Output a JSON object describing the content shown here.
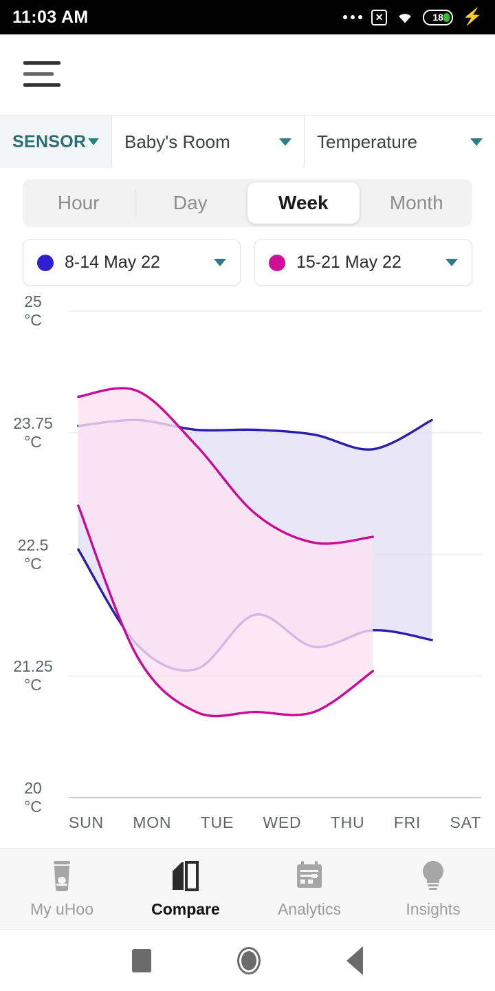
{
  "status_bar": {
    "time": "11:03 AM",
    "battery_level": "18",
    "icons": [
      "more-dots-icon",
      "x-box-icon",
      "wifi-icon",
      "battery-icon",
      "charging-bolt-icon"
    ]
  },
  "app_bar": {
    "menu_icon": "hamburger-menu-icon"
  },
  "selectors": [
    {
      "name": "sensor",
      "label": "SENSOR",
      "accent": "#2b6e76"
    },
    {
      "name": "room",
      "label": "Baby's Room"
    },
    {
      "name": "metric",
      "label": "Temperature"
    }
  ],
  "range_tabs": {
    "items": [
      "Hour",
      "Day",
      "Week",
      "Month"
    ],
    "selected": "Week"
  },
  "date_pickers": [
    {
      "label": "8-14 May 22",
      "color": "#2f1fd0"
    },
    {
      "label": "15-21 May 22",
      "color": "#cf0d98"
    }
  ],
  "bottom_nav": {
    "items": [
      {
        "label": "My uHoo",
        "icon": "device-icon",
        "active": false
      },
      {
        "label": "Compare",
        "icon": "compare-icon",
        "active": true
      },
      {
        "label": "Analytics",
        "icon": "calendar-icon",
        "active": false
      },
      {
        "label": "Insights",
        "icon": "lightbulb-icon",
        "active": false
      }
    ]
  },
  "system_nav": {
    "items": [
      "recents-square-icon",
      "home-circle-icon",
      "back-triangle-icon"
    ]
  },
  "chart_data": {
    "type": "area",
    "title": "",
    "xlabel": "",
    "ylabel": "°C",
    "ylim": [
      20,
      25
    ],
    "yticks": [
      25,
      23.75,
      22.5,
      21.25,
      20
    ],
    "ytick_labels": [
      "25\n°C",
      "23.75\n°C",
      "22.5\n°C",
      "21.25\n°C",
      "20\n°C"
    ],
    "categories": [
      "SUN",
      "MON",
      "TUE",
      "WED",
      "THU",
      "FRI",
      "SAT"
    ],
    "grid": true,
    "legend_position": "top",
    "series": [
      {
        "name": "8-14 May 22",
        "color": "#2a1ea8",
        "fill": "#e4e2f6",
        "band": true,
        "x": [
          "SUN",
          "MON",
          "TUE",
          "WED",
          "THU",
          "FRI",
          "SAT"
        ],
        "upper": [
          23.82,
          23.88,
          23.78,
          23.78,
          23.73,
          23.58,
          23.88
        ],
        "lower": [
          22.55,
          21.57,
          21.32,
          21.88,
          21.55,
          21.72,
          21.62
        ]
      },
      {
        "name": "15-21 May 22",
        "color": "#c70b94",
        "fill": "#fbe2f2",
        "band": true,
        "x": [
          "SUN",
          "MON",
          "TUE",
          "WED",
          "THU",
          "FRI"
        ],
        "upper": [
          24.12,
          24.18,
          23.62,
          22.92,
          22.62,
          22.68
        ],
        "lower": [
          23.0,
          21.45,
          20.88,
          20.88,
          20.88,
          21.3
        ]
      }
    ]
  }
}
